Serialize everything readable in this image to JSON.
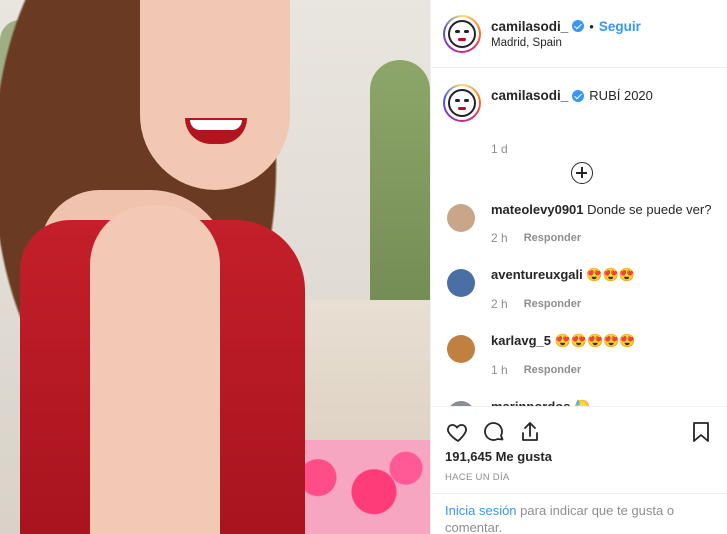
{
  "post": {
    "author": "camilasodi_",
    "separator": "•",
    "follow_label": "Seguir",
    "location": "Madrid, Spain",
    "caption_user": "camilasodi_",
    "caption_text": "RUBÍ 2020",
    "caption_age": "1 d"
  },
  "comments": [
    {
      "user": "mateolevy0901",
      "text": "Donde se puede ver?",
      "age": "2 h",
      "reply": "Responder",
      "avatar_color": "#c9a58a"
    },
    {
      "user": "aventureuxgali",
      "text": "😍😍😍",
      "age": "2 h",
      "reply": "Responder",
      "avatar_color": "#4a6fa5"
    },
    {
      "user": "karlavg_5",
      "text": "😍😍😍😍😍",
      "age": "1 h",
      "reply": "Responder",
      "avatar_color": "#c08040"
    },
    {
      "user": "marinpordos",
      "text": "😓",
      "age": "",
      "reply": "",
      "avatar_color": "#8a8f94"
    }
  ],
  "actions": {
    "likes": "191,645 Me gusta",
    "time_ago": "HACE UN DÍA",
    "login_link": "Inicia sesión",
    "login_rest": " para indicar que te gusta o comentar."
  },
  "colors": {
    "accent": "#3897f0",
    "muted": "#8e8e8e",
    "text": "#262626"
  }
}
